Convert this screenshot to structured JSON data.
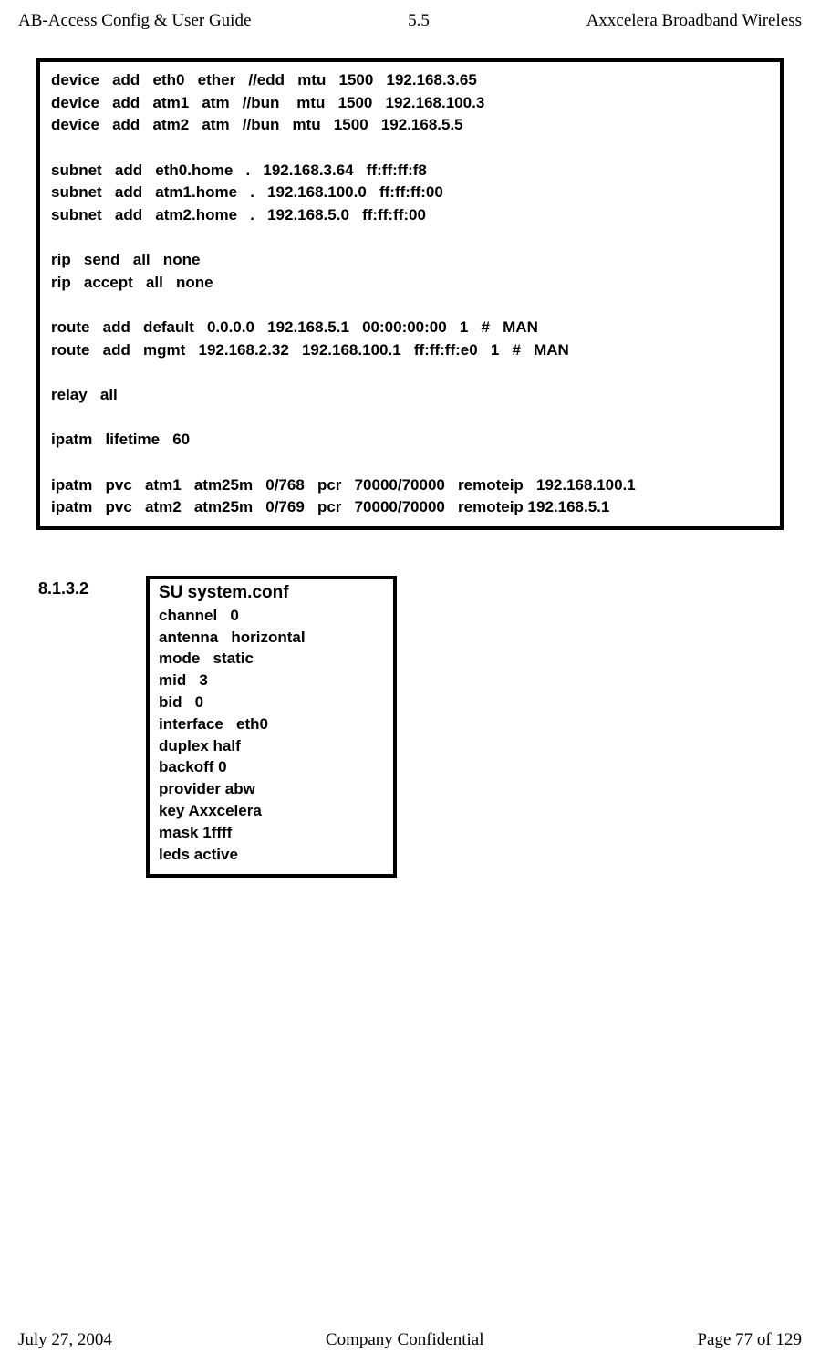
{
  "header": {
    "left": "AB-Access Config & User Guide",
    "center": "5.5",
    "right": "Axxcelera Broadband Wireless"
  },
  "code_block_1": "device   add   eth0   ether   //edd   mtu   1500   192.168.3.65\ndevice   add   atm1   atm   //bun    mtu   1500   192.168.100.3\ndevice   add   atm2   atm   //bun   mtu   1500   192.168.5.5\n\nsubnet   add   eth0.home   .   192.168.3.64   ff:ff:ff:f8\nsubnet   add   atm1.home   .   192.168.100.0   ff:ff:ff:00\nsubnet   add   atm2.home   .   192.168.5.0   ff:ff:ff:00\n\nrip   send   all   none\nrip   accept   all   none\n\nroute   add   default   0.0.0.0   192.168.5.1   00:00:00:00   1   #   MAN\nroute   add   mgmt   192.168.2.32   192.168.100.1   ff:ff:ff:e0   1   #   MAN\n\nrelay   all\n\nipatm   lifetime   60\n\nipatm   pvc   atm1   atm25m   0/768   pcr   70000/70000   remoteip   192.168.100.1\nipatm   pvc   atm2   atm25m   0/769   pcr   70000/70000   remoteip 192.168.5.1\n",
  "section": {
    "number": "8.1.3.2",
    "title": "SU system.conf",
    "body": "channel   0\nantenna   horizontal\nmode   static\nmid   3\nbid   0\ninterface   eth0\nduplex half\nbackoff 0\nprovider abw\nkey Axxcelera\nmask 1ffff\nleds active"
  },
  "footer": {
    "left": "July 27, 2004",
    "center": "Company Confidential",
    "right": "Page 77 of 129"
  }
}
